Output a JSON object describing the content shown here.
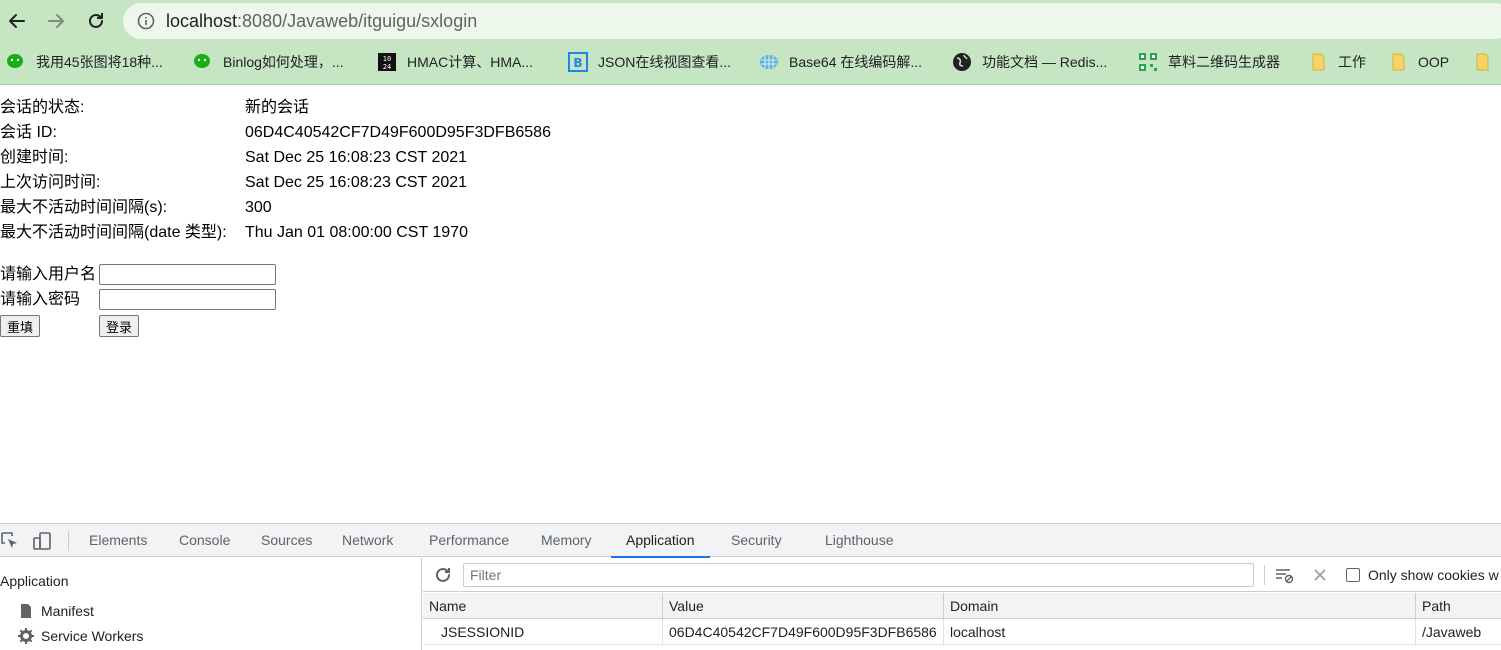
{
  "browser": {
    "url_host": "localhost",
    "url_rest": ":8080/Javaweb/itguigu/sxlogin",
    "bookmarks": [
      {
        "icon": "wechat-icon",
        "label": "我用45张图将18种..."
      },
      {
        "icon": "wechat-icon",
        "label": "Binlog如何处理，..."
      },
      {
        "icon": "hmac-icon",
        "label": "HMAC计算、HMA..."
      },
      {
        "icon": "json-icon",
        "label": "JSON在线视图查看..."
      },
      {
        "icon": "base64-icon",
        "label": "Base64 在线编码解..."
      },
      {
        "icon": "globe-icon",
        "label": "功能文档 — Redis..."
      },
      {
        "icon": "qrcode-icon",
        "label": "草料二维码生成器"
      },
      {
        "icon": "folder-icon",
        "label": "工作"
      },
      {
        "icon": "folder-icon",
        "label": "OOP"
      },
      {
        "icon": "folder-icon",
        "label": ""
      }
    ],
    "colors": {
      "chrome": "#c6e6c3",
      "address_bar": "#edf7ec",
      "accent": "#1a73e8"
    }
  },
  "session": {
    "rows": [
      {
        "key": "会话的状态:",
        "value": "新的会话"
      },
      {
        "key": "会话 ID:",
        "value": "06D4C40542CF7D49F600D95F3DFB6586"
      },
      {
        "key": "创建时间:",
        "value": "Sat Dec 25 16:08:23 CST 2021"
      },
      {
        "key": "上次访问时间:",
        "value": "Sat Dec 25 16:08:23 CST 2021"
      },
      {
        "key": "最大不活动时间间隔(s):",
        "value": "300"
      },
      {
        "key": "最大不活动时间间隔(date 类型):",
        "value": "Thu Jan 01 08:00:00 CST 1970"
      }
    ]
  },
  "login": {
    "username_label": "请输入用户名",
    "username_value": "",
    "password_label": "请输入密码",
    "password_value": "",
    "reset_label": "重填",
    "submit_label": "登录"
  },
  "devtools": {
    "tabs": [
      "Elements",
      "Console",
      "Sources",
      "Network",
      "Performance",
      "Memory",
      "Application",
      "Security",
      "Lighthouse"
    ],
    "active_tab": "Application",
    "sidebar": {
      "heading": "Application",
      "items": [
        {
          "icon": "document-icon",
          "label": "Manifest"
        },
        {
          "icon": "gear-icon",
          "label": "Service Workers"
        }
      ]
    },
    "filter_placeholder": "Filter",
    "only_show_cookies_label": "Only show cookies w",
    "table": {
      "columns": [
        "Name",
        "Value",
        "Domain",
        "Path"
      ],
      "rows": [
        [
          "JSESSIONID",
          "06D4C40542CF7D49F600D95F3DFB6586",
          "localhost",
          "/Javaweb"
        ]
      ]
    }
  }
}
